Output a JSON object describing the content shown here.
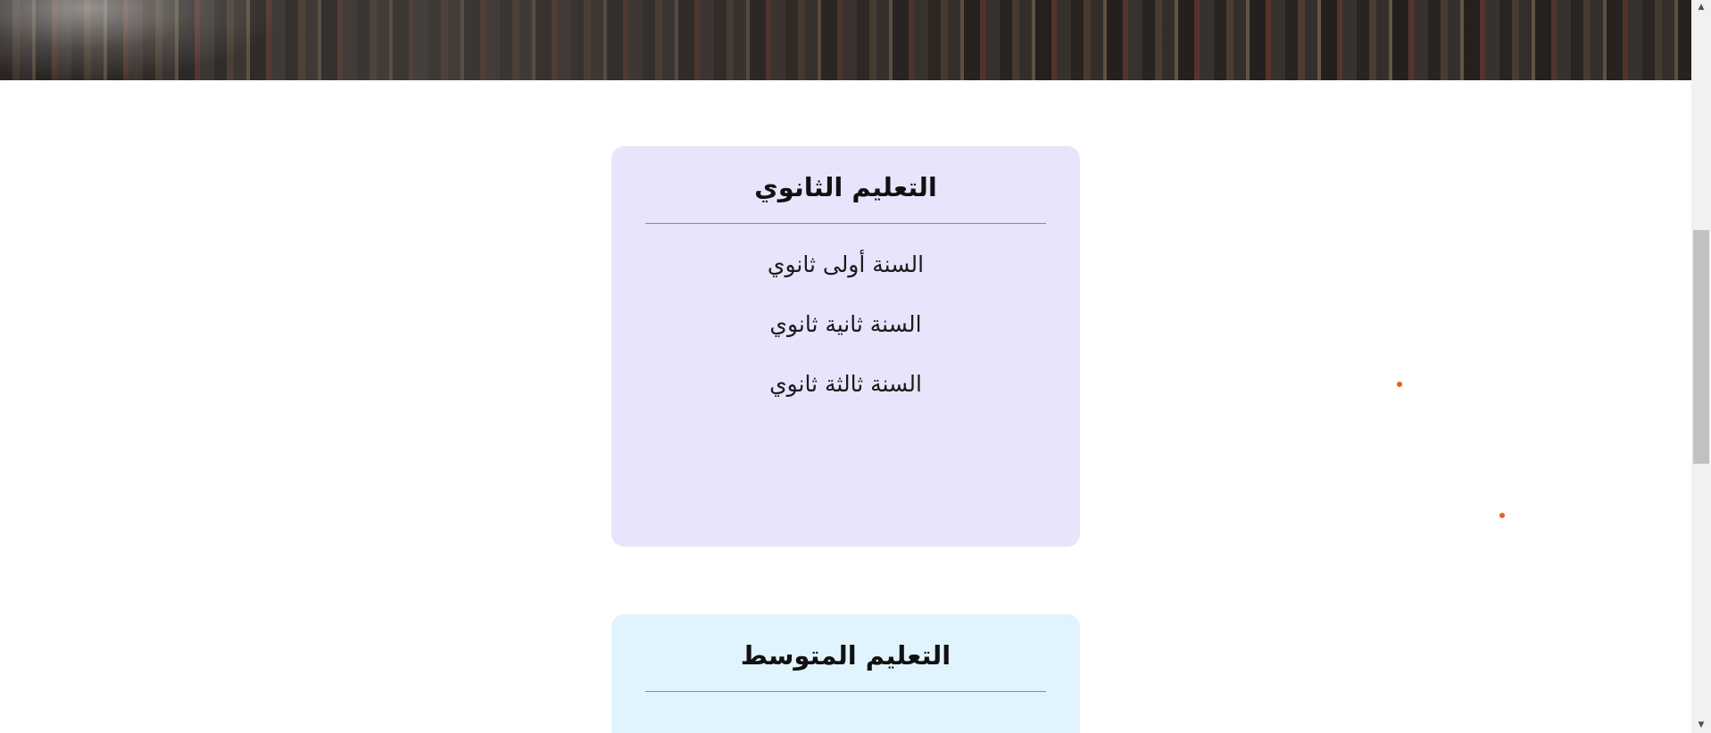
{
  "hero": {
    "image_alt": "library-bookshelves-banner"
  },
  "secondary_education": {
    "title": "التعليم الثانوي",
    "years": [
      {
        "label": "السنة أولى ثانوي"
      },
      {
        "label": "السنة ثانية ثانوي"
      },
      {
        "label": "السنة ثالثة ثانوي"
      }
    ],
    "background_color": "#e6e5fb"
  },
  "middle_education": {
    "title": "التعليم المتوسط",
    "background_color": "#e1f3fd"
  },
  "decorations": {
    "dot_color": "#e8601e"
  },
  "scrollbar": {
    "up_icon": "scroll-up-arrow-icon",
    "down_icon": "scroll-down-arrow-icon"
  }
}
